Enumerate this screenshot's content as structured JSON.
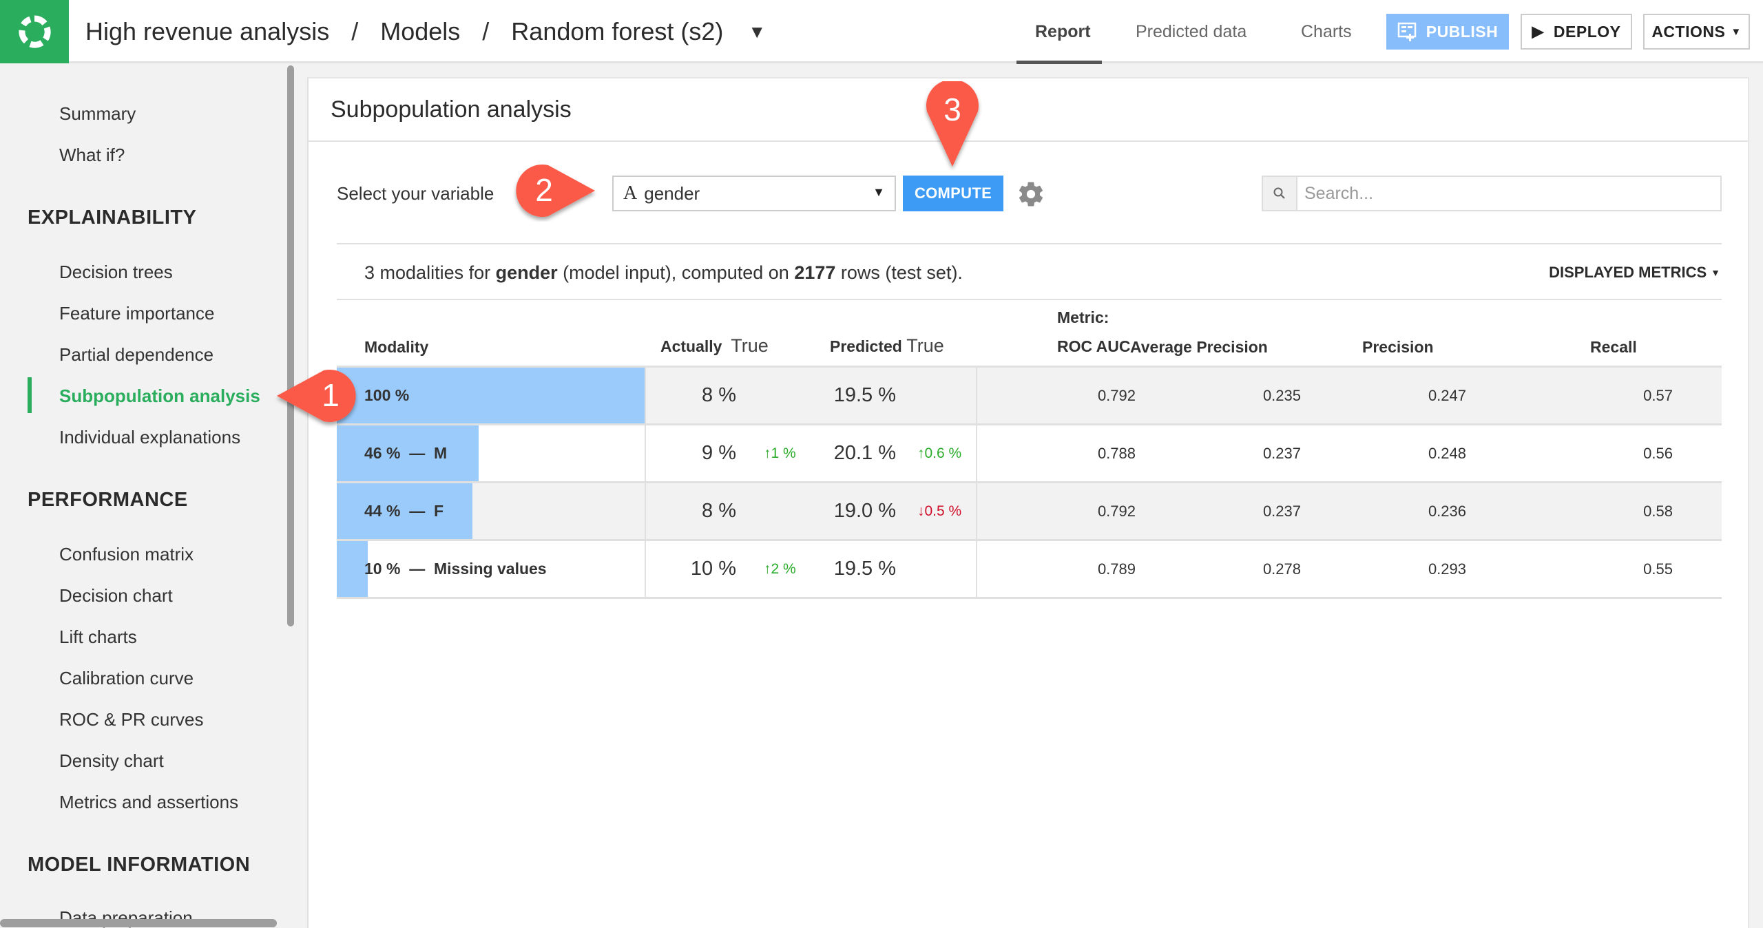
{
  "header": {
    "breadcrumb": [
      "High revenue analysis",
      "Models",
      "Random forest (s2)"
    ],
    "separator": "/",
    "tabs": [
      {
        "label": "Report",
        "active": true
      },
      {
        "label": "Predicted data",
        "active": false
      },
      {
        "label": "Charts",
        "active": false
      }
    ],
    "buttons": {
      "publish": "PUBLISH",
      "deploy": "DEPLOY",
      "actions": "ACTIONS"
    },
    "brand_color": "#2aad5c"
  },
  "sidebar": {
    "top_items": [
      "Summary",
      "What if?"
    ],
    "sections": [
      {
        "title": "EXPLAINABILITY",
        "items": [
          "Decision trees",
          "Feature importance",
          "Partial dependence",
          "Subpopulation analysis",
          "Individual explanations"
        ]
      },
      {
        "title": "PERFORMANCE",
        "items": [
          "Confusion matrix",
          "Decision chart",
          "Lift charts",
          "Calibration curve",
          "ROC & PR curves",
          "Density chart",
          "Metrics and assertions"
        ]
      },
      {
        "title": "MODEL INFORMATION",
        "items": [
          "Data preparation"
        ]
      }
    ],
    "active_item": "Subpopulation analysis"
  },
  "panel": {
    "title": "Subpopulation analysis",
    "variable_label": "Select your variable",
    "variable_type_glyph": "A",
    "variable_value": "gender",
    "compute_label": "COMPUTE",
    "search_placeholder": "Search...",
    "summary": {
      "count": "3",
      "prefix": " modalities for ",
      "variable": "gender",
      "middle": " (model input), computed on ",
      "rows": "2177",
      "suffix": " rows (test set)."
    },
    "displayed_metrics_label": "DISPLAYED METRICS"
  },
  "table": {
    "headers": {
      "modality": "Modality",
      "actually": "Actually",
      "actually_value": "True",
      "predicted": "Predicted",
      "predicted_value": "True",
      "metric_prefix": "Metric:",
      "roc_auc": "ROC AUC",
      "avg_precision": "Average Precision",
      "precision": "Precision",
      "recall": "Recall"
    },
    "rows": [
      {
        "modality": "100 %",
        "share": 1.0,
        "actually": "8 %",
        "actually_delta": "",
        "actually_dir": "",
        "predicted": "19.5 %",
        "predicted_delta": "",
        "predicted_dir": "",
        "roc_auc": "0.792",
        "avg_precision": "0.235",
        "precision": "0.247",
        "recall": "0.57"
      },
      {
        "modality": "46 %  —  M",
        "share": 0.46,
        "actually": "9 %",
        "actually_delta": "1 %",
        "actually_dir": "up",
        "predicted": "20.1 %",
        "predicted_delta": "0.6 %",
        "predicted_dir": "up",
        "roc_auc": "0.788",
        "avg_precision": "0.237",
        "precision": "0.248",
        "recall": "0.56"
      },
      {
        "modality": "44 %  —  F",
        "share": 0.44,
        "actually": "8 %",
        "actually_delta": "",
        "actually_dir": "",
        "predicted": "19.0 %",
        "predicted_delta": "0.5 %",
        "predicted_dir": "down",
        "roc_auc": "0.792",
        "avg_precision": "0.237",
        "precision": "0.236",
        "recall": "0.58"
      },
      {
        "modality": "10 %  —  Missing values",
        "share": 0.1,
        "actually": "10 %",
        "actually_delta": "2 %",
        "actually_dir": "up",
        "predicted": "19.5 %",
        "predicted_delta": "",
        "predicted_dir": "",
        "roc_auc": "0.789",
        "avg_precision": "0.278",
        "precision": "0.293",
        "recall": "0.55"
      }
    ]
  },
  "callouts": [
    "1",
    "2",
    "3"
  ],
  "colors": {
    "accent_green": "#2aad5c",
    "compute_blue": "#3d9bf5",
    "publish_blue": "#87bdfb",
    "bar_blue": "#9bcbfb",
    "up_green": "#2aad2a",
    "down_red": "#d0102a",
    "callout_red": "#fb5a48"
  }
}
